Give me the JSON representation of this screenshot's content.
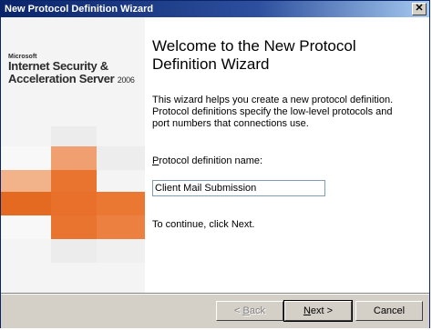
{
  "window": {
    "title": "New Protocol Definition Wizard"
  },
  "brand": {
    "company": "Microsoft",
    "product_line1": "Internet Security &",
    "product_line2": "Acceleration Server",
    "year": "2006"
  },
  "heading": "Welcome to the New Protocol Definition Wizard",
  "description": "This wizard helps you create a new protocol definition. Protocol definitions specify the low-level protocols and port numbers that connections use.",
  "name_field": {
    "label_prefix": "P",
    "label_rest": "rotocol definition name:",
    "value": "Client Mail Submission"
  },
  "hint": "To continue, click Next.",
  "buttons": {
    "back_prefix": "< ",
    "back_key": "B",
    "back_rest": "ack",
    "next_key": "N",
    "next_rest": "ext >",
    "cancel": "Cancel"
  },
  "colors": {
    "accent_orange": "#e8702a",
    "light_orange": "#f4a068",
    "title_bar": "#0a246a"
  }
}
